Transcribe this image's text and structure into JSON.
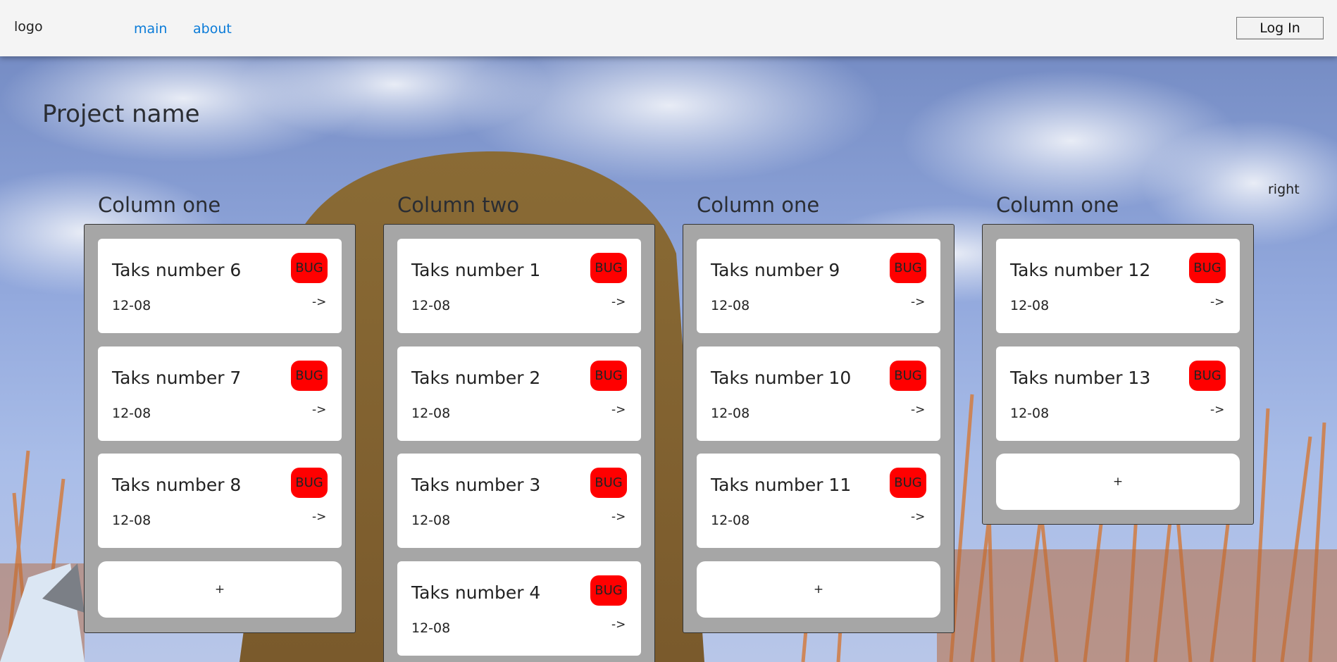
{
  "navbar": {
    "logo": "logo",
    "links": [
      "main",
      "about"
    ],
    "login_label": "Log In"
  },
  "page": {
    "project_name": "Project name",
    "right_label": "right"
  },
  "colors": {
    "badge": "#ff0000",
    "link": "#0a7bd8",
    "column_bg": "#a6a6a6"
  },
  "columns": [
    {
      "title": "Column one",
      "add_label": "+",
      "cards": [
        {
          "title": "Taks number 6",
          "badge": "BUG",
          "date": "12-08",
          "arrow": "->"
        },
        {
          "title": "Taks number 7",
          "badge": "BUG",
          "date": "12-08",
          "arrow": "->"
        },
        {
          "title": "Taks number 8",
          "badge": "BUG",
          "date": "12-08",
          "arrow": "->"
        }
      ]
    },
    {
      "title": "Column two",
      "add_label": "",
      "cards": [
        {
          "title": "Taks number 1",
          "badge": "BUG",
          "date": "12-08",
          "arrow": "->"
        },
        {
          "title": "Taks number 2",
          "badge": "BUG",
          "date": "12-08",
          "arrow": "->"
        },
        {
          "title": "Taks number 3",
          "badge": "BUG",
          "date": "12-08",
          "arrow": "->"
        },
        {
          "title": "Taks number 4",
          "badge": "BUG",
          "date": "12-08",
          "arrow": "->"
        }
      ]
    },
    {
      "title": "Column one",
      "add_label": "+",
      "cards": [
        {
          "title": "Taks number 9",
          "badge": "BUG",
          "date": "12-08",
          "arrow": "->"
        },
        {
          "title": "Taks number 10",
          "badge": "BUG",
          "date": "12-08",
          "arrow": "->"
        },
        {
          "title": "Taks number 11",
          "badge": "BUG",
          "date": "12-08",
          "arrow": "->"
        }
      ]
    },
    {
      "title": "Column one",
      "add_label": "+",
      "cards": [
        {
          "title": "Taks number 12",
          "badge": "BUG",
          "date": "12-08",
          "arrow": "->"
        },
        {
          "title": "Taks number 13",
          "badge": "BUG",
          "date": "12-08",
          "arrow": "->"
        }
      ]
    }
  ]
}
